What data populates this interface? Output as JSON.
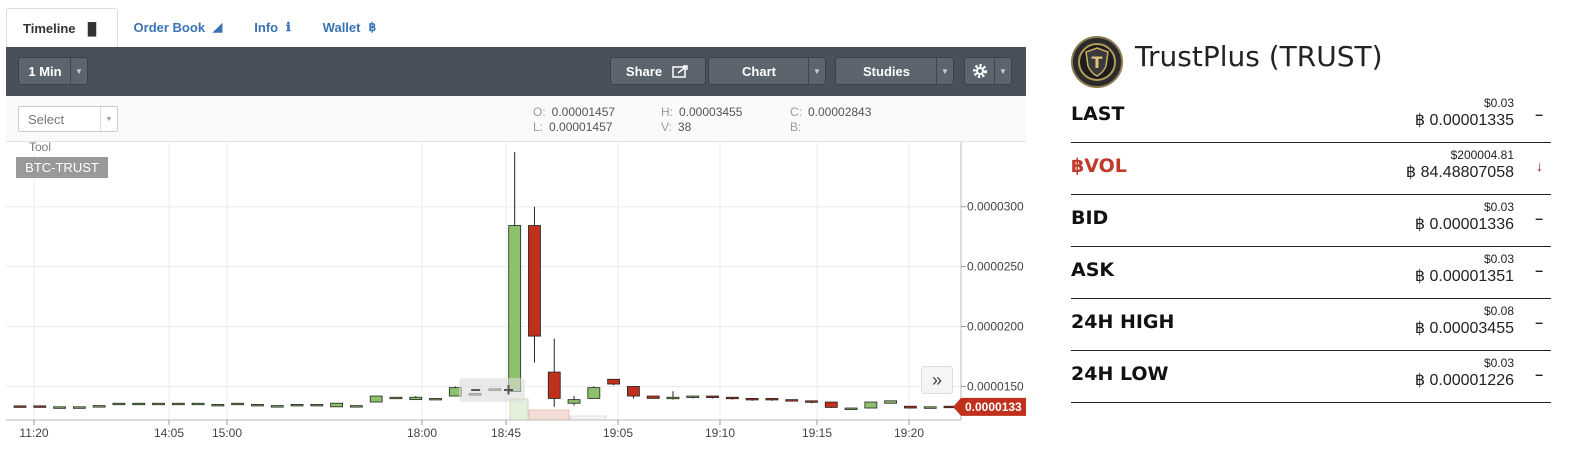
{
  "tabs": [
    {
      "label": "Timeline",
      "icon": "bar-chart-icon",
      "glyph": "▐▌",
      "active": true
    },
    {
      "label": "Order Book",
      "icon": "area-chart-icon",
      "glyph": "◢",
      "active": false
    },
    {
      "label": "Info",
      "icon": "info-icon",
      "glyph": "ℹ",
      "active": false
    },
    {
      "label": "Wallet",
      "icon": "bitcoin-icon",
      "glyph": "฿",
      "active": false
    }
  ],
  "toolbar": {
    "interval": "1 Min",
    "share": "Share",
    "chart": "Chart",
    "studies": "Studies"
  },
  "subbar": {
    "select_placeholder": "Select",
    "tool_label": "Tool",
    "symbol": "BTC-TRUST"
  },
  "ohlc": {
    "o_label": "O:",
    "o": "0.00001457",
    "h_label": "H:",
    "h": "0.00003455",
    "c_label": "C:",
    "c": "0.00002843",
    "l_label": "L:",
    "l": "0.00001457",
    "v_label": "V:",
    "v": "38",
    "b_label": "B:",
    "b": ""
  },
  "chart_data": {
    "type": "candlestick",
    "x_tick_labels": [
      "11:20",
      "14:05",
      "15:00",
      "18:00",
      "18:45",
      "19:05",
      "19:10",
      "19:15",
      "19:20"
    ],
    "y_tick_labels": [
      "0.0000300",
      "0.0000250",
      "0.0000200",
      "0.0000150"
    ],
    "y_ticks": [
      3e-05,
      2.5e-05,
      2e-05,
      1.5e-05
    ],
    "ylim": [
      1.22e-05,
      3.54e-05
    ],
    "last_price_label": "0.0000133",
    "last_price": 1.33e-05,
    "up_color": "#8cc06a",
    "down_color": "#c0311d",
    "candles": [
      {
        "o": 1.338e-05,
        "h": 1.338e-05,
        "l": 1.338e-05,
        "c": 1.33e-05
      },
      {
        "o": 1.338e-05,
        "h": 1.338e-05,
        "l": 1.338e-05,
        "c": 1.33e-05
      },
      {
        "o": 1.33e-05,
        "h": 1.33e-05,
        "l": 1.33e-05,
        "c": 1.33e-05
      },
      {
        "o": 1.33e-05,
        "h": 1.33e-05,
        "l": 1.33e-05,
        "c": 1.33e-05
      },
      {
        "o": 1.34e-05,
        "h": 1.34e-05,
        "l": 1.34e-05,
        "c": 1.34e-05
      },
      {
        "o": 1.36e-05,
        "h": 1.36e-05,
        "l": 1.36e-05,
        "c": 1.36e-05
      },
      {
        "o": 1.36e-05,
        "h": 1.36e-05,
        "l": 1.36e-05,
        "c": 1.36e-05
      },
      {
        "o": 1.36e-05,
        "h": 1.36e-05,
        "l": 1.36e-05,
        "c": 1.36e-05
      },
      {
        "o": 1.36e-05,
        "h": 1.36e-05,
        "l": 1.36e-05,
        "c": 1.36e-05
      },
      {
        "o": 1.36e-05,
        "h": 1.36e-05,
        "l": 1.36e-05,
        "c": 1.36e-05
      },
      {
        "o": 1.35e-05,
        "h": 1.35e-05,
        "l": 1.35e-05,
        "c": 1.35e-05
      },
      {
        "o": 1.36e-05,
        "h": 1.36e-05,
        "l": 1.36e-05,
        "c": 1.36e-05
      },
      {
        "o": 1.35e-05,
        "h": 1.35e-05,
        "l": 1.35e-05,
        "c": 1.35e-05
      },
      {
        "o": 1.34e-05,
        "h": 1.34e-05,
        "l": 1.34e-05,
        "c": 1.34e-05
      },
      {
        "o": 1.35e-05,
        "h": 1.35e-05,
        "l": 1.35e-05,
        "c": 1.35e-05
      },
      {
        "o": 1.35e-05,
        "h": 1.35e-05,
        "l": 1.35e-05,
        "c": 1.35e-05
      },
      {
        "o": 1.33e-05,
        "h": 1.36e-05,
        "l": 1.33e-05,
        "c": 1.36e-05
      },
      {
        "o": 1.34e-05,
        "h": 1.34e-05,
        "l": 1.34e-05,
        "c": 1.34e-05
      },
      {
        "o": 1.37e-05,
        "h": 1.42e-05,
        "l": 1.37e-05,
        "c": 1.42e-05
      },
      {
        "o": 1.41e-05,
        "h": 1.41e-05,
        "l": 1.41e-05,
        "c": 1.41e-05
      },
      {
        "o": 1.39e-05,
        "h": 1.42e-05,
        "l": 1.39e-05,
        "c": 1.41e-05
      },
      {
        "o": 1.4e-05,
        "h": 1.4e-05,
        "l": 1.4e-05,
        "c": 1.4e-05
      },
      {
        "o": 1.42e-05,
        "h": 1.5e-05,
        "l": 1.42e-05,
        "c": 1.49e-05
      },
      {
        "o": 1.44e-05,
        "h": 1.44e-05,
        "l": 1.44e-05,
        "c": 1.44e-05
      },
      {
        "o": 1.48e-05,
        "h": 1.48e-05,
        "l": 1.48e-05,
        "c": 1.48e-05
      },
      {
        "o": 1.457e-05,
        "h": 3.455e-05,
        "l": 1.457e-05,
        "c": 2.843e-05
      },
      {
        "o": 2.843e-05,
        "h": 3e-05,
        "l": 1.7e-05,
        "c": 1.92e-05
      },
      {
        "o": 1.62e-05,
        "h": 1.9e-05,
        "l": 1.33e-05,
        "c": 1.4e-05
      },
      {
        "o": 1.36e-05,
        "h": 1.42e-05,
        "l": 1.34e-05,
        "c": 1.39e-05
      },
      {
        "o": 1.4e-05,
        "h": 1.5e-05,
        "l": 1.4e-05,
        "c": 1.49e-05
      },
      {
        "o": 1.56e-05,
        "h": 1.56e-05,
        "l": 1.51e-05,
        "c": 1.52e-05
      },
      {
        "o": 1.5e-05,
        "h": 1.5e-05,
        "l": 1.4e-05,
        "c": 1.42e-05
      },
      {
        "o": 1.42e-05,
        "h": 1.42e-05,
        "l": 1.4e-05,
        "c": 1.4e-05
      },
      {
        "o": 1.4e-05,
        "h": 1.46e-05,
        "l": 1.39e-05,
        "c": 1.41e-05
      },
      {
        "o": 1.41e-05,
        "h": 1.42e-05,
        "l": 1.4e-05,
        "c": 1.42e-05
      },
      {
        "o": 1.42e-05,
        "h": 1.42e-05,
        "l": 1.4e-05,
        "c": 1.41e-05
      },
      {
        "o": 1.41e-05,
        "h": 1.41e-05,
        "l": 1.39e-05,
        "c": 1.4e-05
      },
      {
        "o": 1.4e-05,
        "h": 1.4e-05,
        "l": 1.38e-05,
        "c": 1.39e-05
      },
      {
        "o": 1.4e-05,
        "h": 1.4e-05,
        "l": 1.38e-05,
        "c": 1.39e-05
      },
      {
        "o": 1.39e-05,
        "h": 1.39e-05,
        "l": 1.38e-05,
        "c": 1.38e-05
      },
      {
        "o": 1.38e-05,
        "h": 1.38e-05,
        "l": 1.36e-05,
        "c": 1.37e-05
      },
      {
        "o": 1.37e-05,
        "h": 1.37e-05,
        "l": 1.32e-05,
        "c": 1.325e-05
      },
      {
        "o": 1.32e-05,
        "h": 1.32e-05,
        "l": 1.32e-05,
        "c": 1.32e-05
      },
      {
        "o": 1.32e-05,
        "h": 1.37e-05,
        "l": 1.32e-05,
        "c": 1.37e-05
      },
      {
        "o": 1.36e-05,
        "h": 1.38e-05,
        "l": 1.36e-05,
        "c": 1.38e-05
      },
      {
        "o": 1.335e-05,
        "h": 1.335e-05,
        "l": 1.315e-05,
        "c": 1.32e-05
      },
      {
        "o": 1.33e-05,
        "h": 1.33e-05,
        "l": 1.33e-05,
        "c": 1.33e-05
      },
      {
        "o": 1.335e-05,
        "h": 1.335e-05,
        "l": 1.33e-05,
        "c": 1.33e-05
      }
    ]
  },
  "coin": {
    "title": "TrustPlus (TRUST)",
    "logo_letter": "T",
    "btc_symbol": "฿",
    "rows": [
      {
        "label": "LAST",
        "usd": "$0.03",
        "btc": "0.00001335",
        "trend": "–",
        "trend_icon": "dash-icon",
        "red": false
      },
      {
        "label": "฿VOL",
        "usd": "$200004.81",
        "btc": "84.48807058",
        "trend": "↓",
        "trend_icon": "arrow-down-icon",
        "red": true
      },
      {
        "label": "BID",
        "usd": "$0.03",
        "btc": "0.00001336",
        "trend": "–",
        "trend_icon": "dash-icon",
        "red": false
      },
      {
        "label": "ASK",
        "usd": "$0.03",
        "btc": "0.00001351",
        "trend": "–",
        "trend_icon": "dash-icon",
        "red": false
      },
      {
        "label": "24H HIGH",
        "usd": "$0.08",
        "btc": "0.00003455",
        "trend": "–",
        "trend_icon": "dash-icon",
        "red": false
      },
      {
        "label": "24H LOW",
        "usd": "$0.03",
        "btc": "0.00001226",
        "trend": "–",
        "trend_icon": "dash-icon",
        "red": false
      }
    ]
  },
  "controls": {
    "zoom_out": "−",
    "zoom_in": "+",
    "scroll_right": "»"
  }
}
